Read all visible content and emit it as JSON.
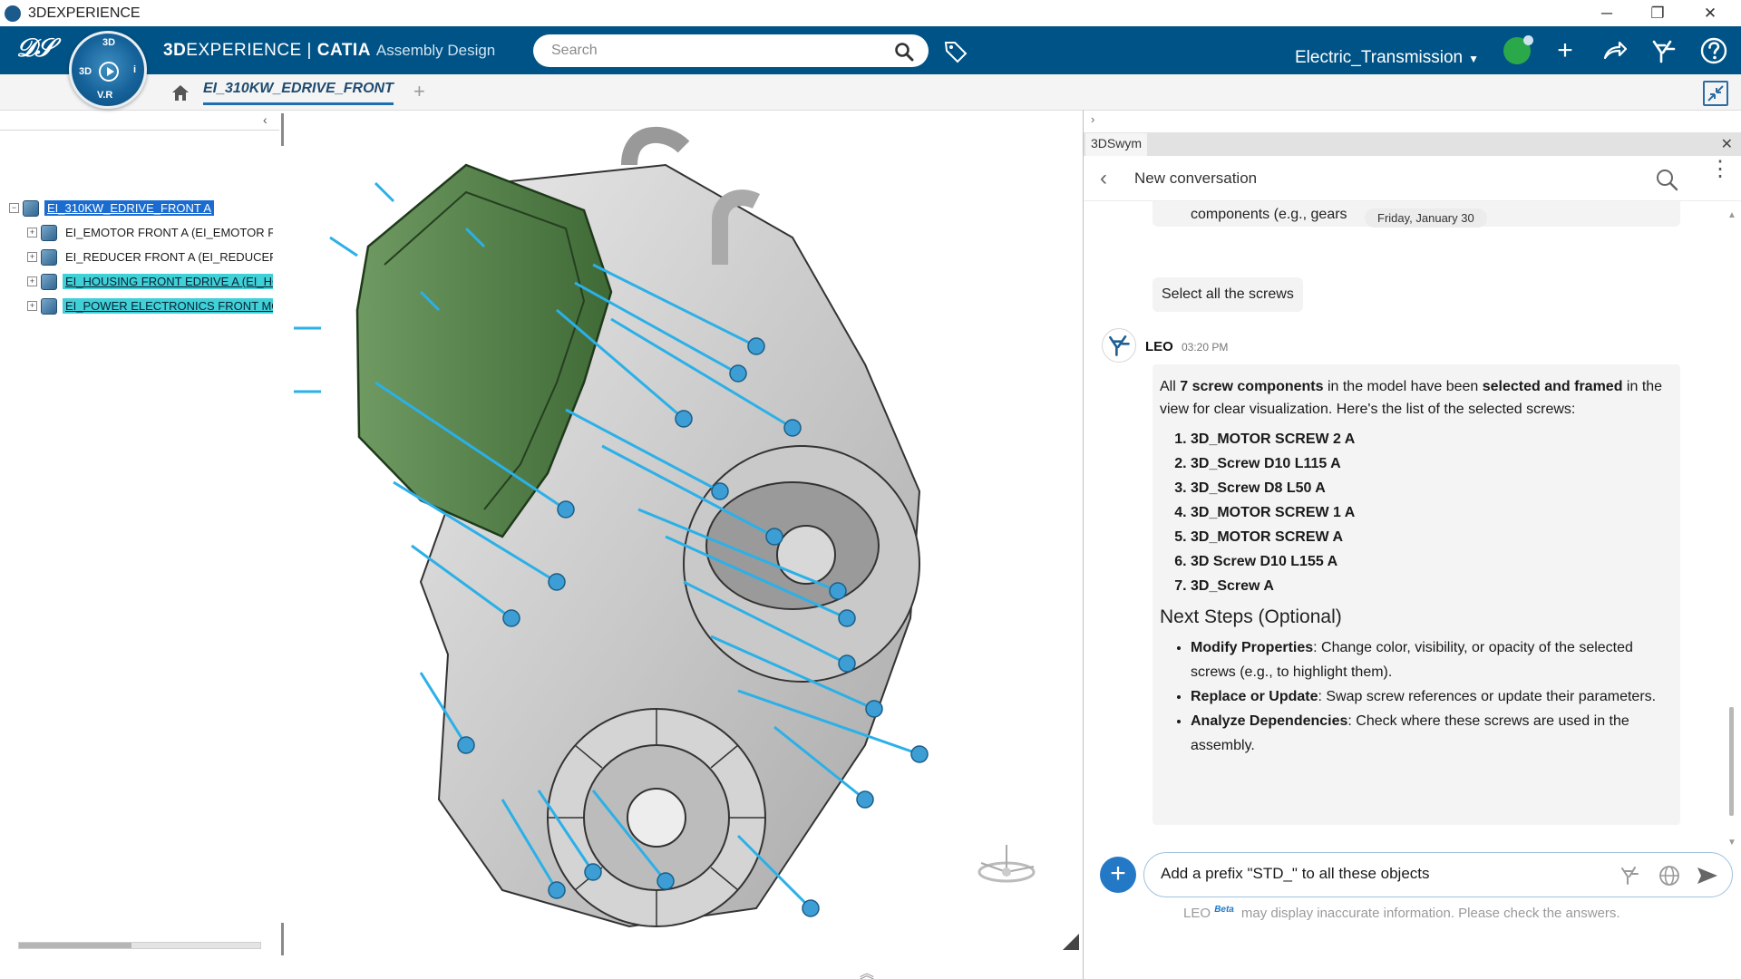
{
  "os": {
    "title": "3DEXPERIENCE",
    "minimize": "─",
    "maximize": "❐",
    "close": "✕"
  },
  "toolbar": {
    "compass": {
      "top": "3D",
      "right": "i",
      "left": "3D",
      "bottom": "V.R"
    },
    "brand_3d": "3D",
    "brand_exp": "EXPERIENCE",
    "brand_sep": " | ",
    "brand_catia": "CATIA",
    "brand_app": "Assembly Design",
    "search_placeholder": "Search",
    "collab_space": "Electric_Transmission",
    "colors": {
      "bar": "#005386",
      "accent": "#2479c6",
      "status": "#2aa84a"
    }
  },
  "tabs": {
    "active": "EI_310KW_EDRIVE_FRONT",
    "add": "+"
  },
  "tree": {
    "nodes": [
      {
        "label": "EI_310KW_EDRIVE_FRONT A",
        "state": "root-selected",
        "expander": "−"
      },
      {
        "label": "EI_EMOTOR FRONT A (EI_EMOTOR FRONT",
        "state": "normal",
        "expander": "+"
      },
      {
        "label": "EI_REDUCER FRONT A (EI_REDUCER FRONT",
        "state": "normal",
        "expander": "+"
      },
      {
        "label": "EI_HOUSING FRONT EDRIVE A (EI_HOUSING",
        "state": "selected",
        "expander": "+"
      },
      {
        "label": "EI_POWER ELECTRONICS FRONT MOTOR",
        "state": "selected",
        "expander": "+"
      }
    ]
  },
  "chat": {
    "panel_tab": "3DSwym",
    "header_title": "New conversation",
    "prev_snippet": "components (e.g., gears",
    "date_divider": "Friday, January 30",
    "user_message": "Select all the screws",
    "leo": {
      "name": "LEO",
      "time": "03:20 PM",
      "intro_1": "All ",
      "intro_bold1": "7 screw components",
      "intro_2": " in the model have been ",
      "intro_bold2": "selected and framed",
      "intro_3": " in the view for clear visualization. Here's the list of the selected screws:",
      "screws": [
        "3D_MOTOR SCREW 2 A",
        "3D_Screw D10 L115 A",
        "3D_Screw D8 L50 A",
        "3D_MOTOR SCREW 1 A",
        "3D_MOTOR SCREW A",
        "3D Screw D10 L155 A",
        "3D_Screw A"
      ],
      "next_heading": "Next Steps (Optional)",
      "steps": [
        {
          "title": "Modify Properties",
          "text": ": Change color, visibility, or opacity of the selected screws (e.g., to highlight them)."
        },
        {
          "title": "Replace or Update",
          "text": ": Swap screw references or update their parameters."
        },
        {
          "title": "Analyze Dependencies",
          "text": ": Check where these screws are used in the assembly."
        }
      ]
    },
    "composer_value": "Add a prefix \"STD_\" to all these objects",
    "disclaimer_name": "LEO",
    "disclaimer_badge": "Beta",
    "disclaimer_text": "may display inaccurate information. Please check the answers."
  }
}
